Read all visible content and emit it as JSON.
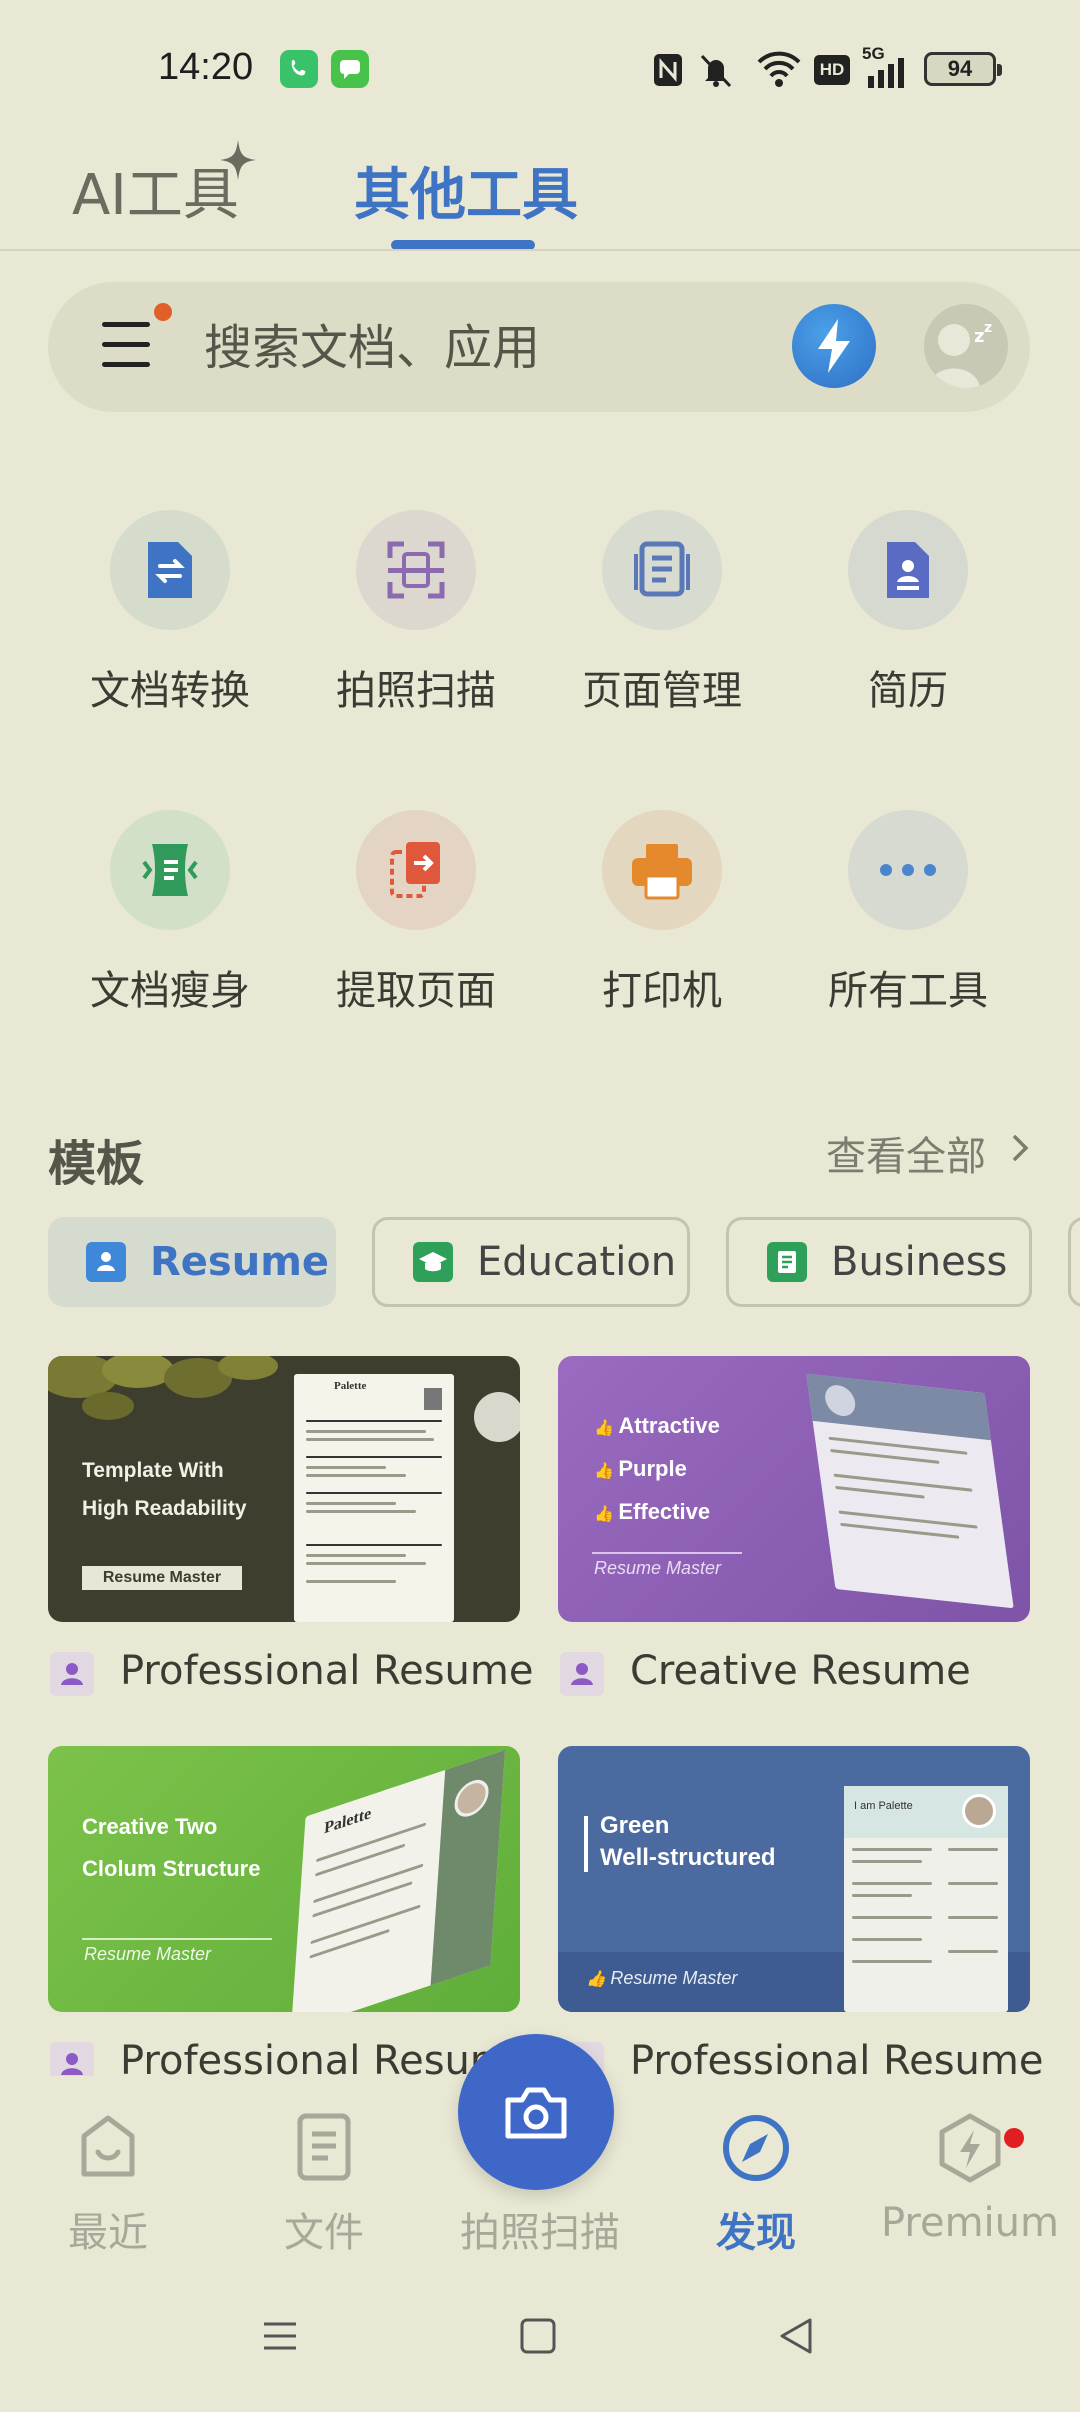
{
  "status_bar": {
    "time": "14:20",
    "battery": "94",
    "network": "5G",
    "hd": "HD"
  },
  "top_tabs": [
    {
      "label": "AI工具",
      "active": false
    },
    {
      "label": "其他工具",
      "active": true
    }
  ],
  "search": {
    "placeholder": "搜索文档、应用"
  },
  "tools": [
    {
      "label": "文档转换",
      "icon": "doc-convert-icon",
      "color": "#3f73c4"
    },
    {
      "label": "拍照扫描",
      "icon": "scan-icon",
      "color": "#8c6ab0"
    },
    {
      "label": "页面管理",
      "icon": "page-manage-icon",
      "color": "#5a78b8"
    },
    {
      "label": "简历",
      "icon": "resume-icon",
      "color": "#5a6bc4"
    },
    {
      "label": "文档瘦身",
      "icon": "doc-slim-icon",
      "color": "#2f9a5a"
    },
    {
      "label": "提取页面",
      "icon": "extract-page-icon",
      "color": "#e0583c"
    },
    {
      "label": "打印机",
      "icon": "printer-icon",
      "color": "#e58a2c"
    },
    {
      "label": "所有工具",
      "icon": "more-icon",
      "color": "#4a86d0"
    }
  ],
  "templates": {
    "title": "模板",
    "view_all": "查看全部",
    "categories": [
      {
        "label": "Resume",
        "active": true
      },
      {
        "label": "Education",
        "active": false
      },
      {
        "label": "Business",
        "active": false
      }
    ],
    "cards": [
      {
        "title": "Professional Resume",
        "caption": [
          "Template With",
          "High Readability"
        ],
        "badge": "Resume Master",
        "doc_name": "Palette"
      },
      {
        "title": "Creative Resume",
        "caption": [
          "Attractive",
          "Purple",
          "Effective"
        ],
        "badge": "Resume Master"
      },
      {
        "title": "Professional Resume",
        "caption": [
          "Creative Two",
          "Clolum Structure"
        ],
        "badge": "Resume Master",
        "doc_name": "Palette"
      },
      {
        "title": "Professional Resume",
        "caption": [
          "Green",
          "Well-structured"
        ],
        "badge": "Resume Master",
        "doc_name": "I am Palette"
      }
    ]
  },
  "bottom_nav": {
    "items": [
      {
        "label": "最近",
        "active": false
      },
      {
        "label": "文件",
        "active": false
      },
      {
        "label": "拍照扫描",
        "active": false
      },
      {
        "label": "发现",
        "active": true
      },
      {
        "label": "Premium",
        "active": false
      }
    ]
  },
  "colors": {
    "accent": "#3f73c4",
    "background": "#e8e8d4",
    "notification": "#e06028"
  }
}
